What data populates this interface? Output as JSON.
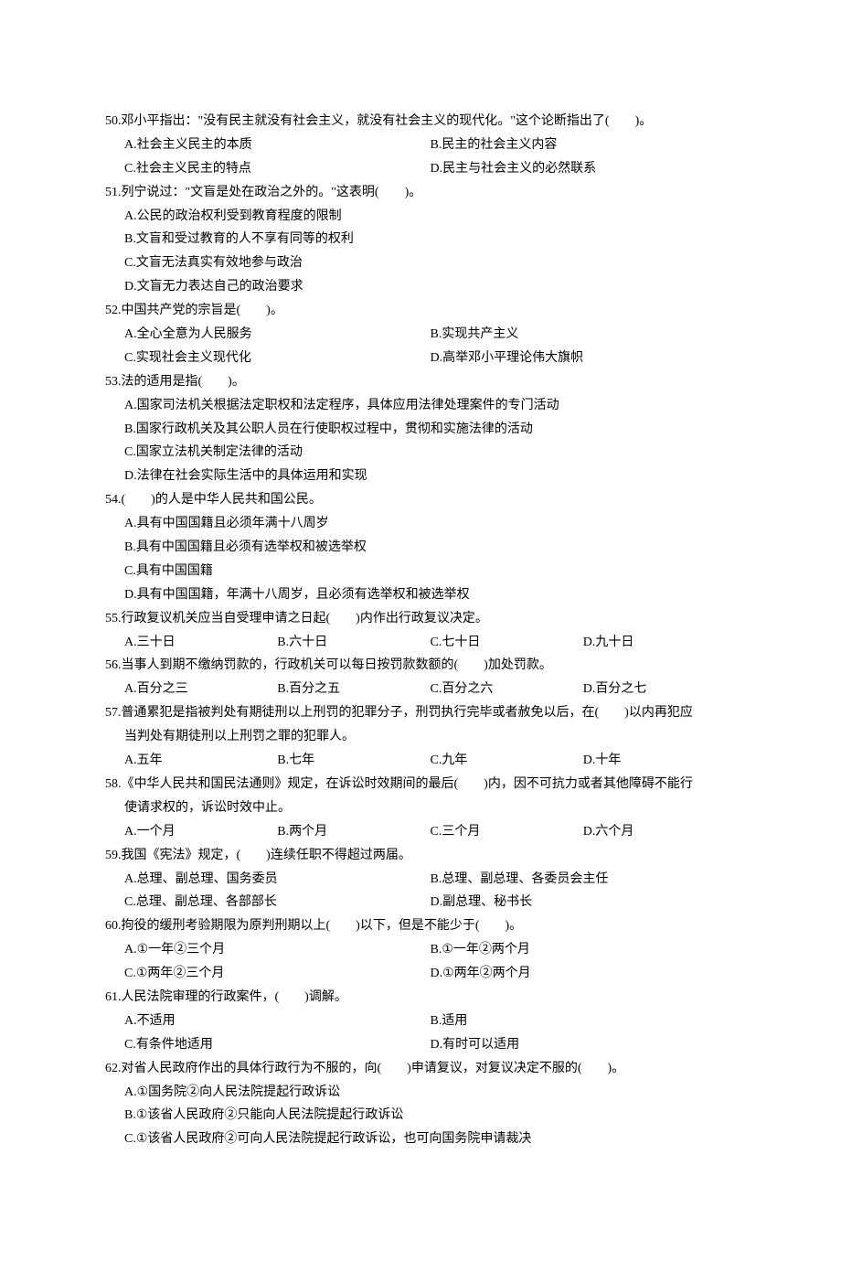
{
  "q50": {
    "stem": "50.邓小平指出：\"没有民主就没有社会主义，就没有社会主义的现代化。\"这个论断指出了(　　)。",
    "a": "A.社会主义民主的本质",
    "b": "B.民主的社会主义内容",
    "c": "C.社会主义民主的特点",
    "d": "D.民主与社会主义的必然联系"
  },
  "q51": {
    "stem": "51.列宁说过：\"文盲是处在政治之外的。\"这表明(　　)。",
    "a": "A.公民的政治权利受到教育程度的限制",
    "b": "B.文盲和受过教育的人不享有同等的权利",
    "c": "C.文盲无法真实有效地参与政治",
    "d": "D.文盲无力表达自己的政治要求"
  },
  "q52": {
    "stem": "52.中国共产党的宗旨是(　　)。",
    "a": "A.全心全意为人民服务",
    "b": "B.实现共产主义",
    "c": "C.实现社会主义现代化",
    "d": "D.高举邓小平理论伟大旗帜"
  },
  "q53": {
    "stem": "53.法的适用是指(　　)。",
    "a": "A.国家司法机关根据法定职权和法定程序，具体应用法律处理案件的专门活动",
    "b": "B.国家行政机关及其公职人员在行使职权过程中，贯彻和实施法律的活动",
    "c": "C.国家立法机关制定法律的活动",
    "d": "D.法律在社会实际生活中的具体运用和实现"
  },
  "q54": {
    "stem": "54.(　　)的人是中华人民共和国公民。",
    "a": "A.具有中国国籍且必须年满十八周岁",
    "b": "B.具有中国国籍且必须有选举权和被选举权",
    "c": "C.具有中国国籍",
    "d": "D.具有中国国籍，年满十八周岁，且必须有选举权和被选举权"
  },
  "q55": {
    "stem": "55.行政复议机关应当自受理申请之日起(　　)内作出行政复议决定。",
    "a": "A.三十日",
    "b": "B.六十日",
    "c": "C.七十日",
    "d": "D.九十日"
  },
  "q56": {
    "stem": "56.当事人到期不缴纳罚款的，行政机关可以每日按罚款数额的(　　)加处罚款。",
    "a": "A.百分之三",
    "b": "B.百分之五",
    "c": "C.百分之六",
    "d": "D.百分之七"
  },
  "q57": {
    "stem1": "57.普通累犯是指被判处有期徒刑以上刑罚的犯罪分子，刑罚执行完毕或者赦免以后，在(　　)以内再犯应",
    "stem2": "当判处有期徒刑以上刑罚之罪的犯罪人。",
    "a": "A.五年",
    "b": "B.七年",
    "c": "C.九年",
    "d": "D.十年"
  },
  "q58": {
    "stem1": "58.《中华人民共和国民法通则》规定，在诉讼时效期间的最后(　　)内，因不可抗力或者其他障碍不能行",
    "stem2": "使请求权的，诉讼时效中止。",
    "a": "A.一个月",
    "b": "B.两个月",
    "c": "C.三个月",
    "d": "D.六个月"
  },
  "q59": {
    "stem": "59.我国《宪法》规定，(　　)连续任职不得超过两届。",
    "a": "A.总理、副总理、国务委员",
    "b": "B.总理、副总理、各委员会主任",
    "c": "C.总理、副总理、各部部长",
    "d": "D.副总理、秘书长"
  },
  "q60": {
    "stem": "60.拘役的缓刑考验期限为原判刑期以上(　　)以下，但是不能少于(　　)。",
    "a": "A.①一年②三个月",
    "b": "B.①一年②两个月",
    "c": "C.①两年②三个月",
    "d": "D.①两年②两个月"
  },
  "q61": {
    "stem": "61.人民法院审理的行政案件，(　　)调解。",
    "a": "A.不适用",
    "b": "B.适用",
    "c": "C.有条件地适用",
    "d": "D.有时可以适用"
  },
  "q62": {
    "stem": "62.对省人民政府作出的具体行政行为不服的，向(　　)申请复议，对复议决定不服的(　　)。",
    "a": "A.①国务院②向人民法院提起行政诉讼",
    "b": "B.①该省人民政府②只能向人民法院提起行政诉讼",
    "c": "C.①该省人民政府②可向人民法院提起行政诉讼，也可向国务院申请裁决"
  }
}
